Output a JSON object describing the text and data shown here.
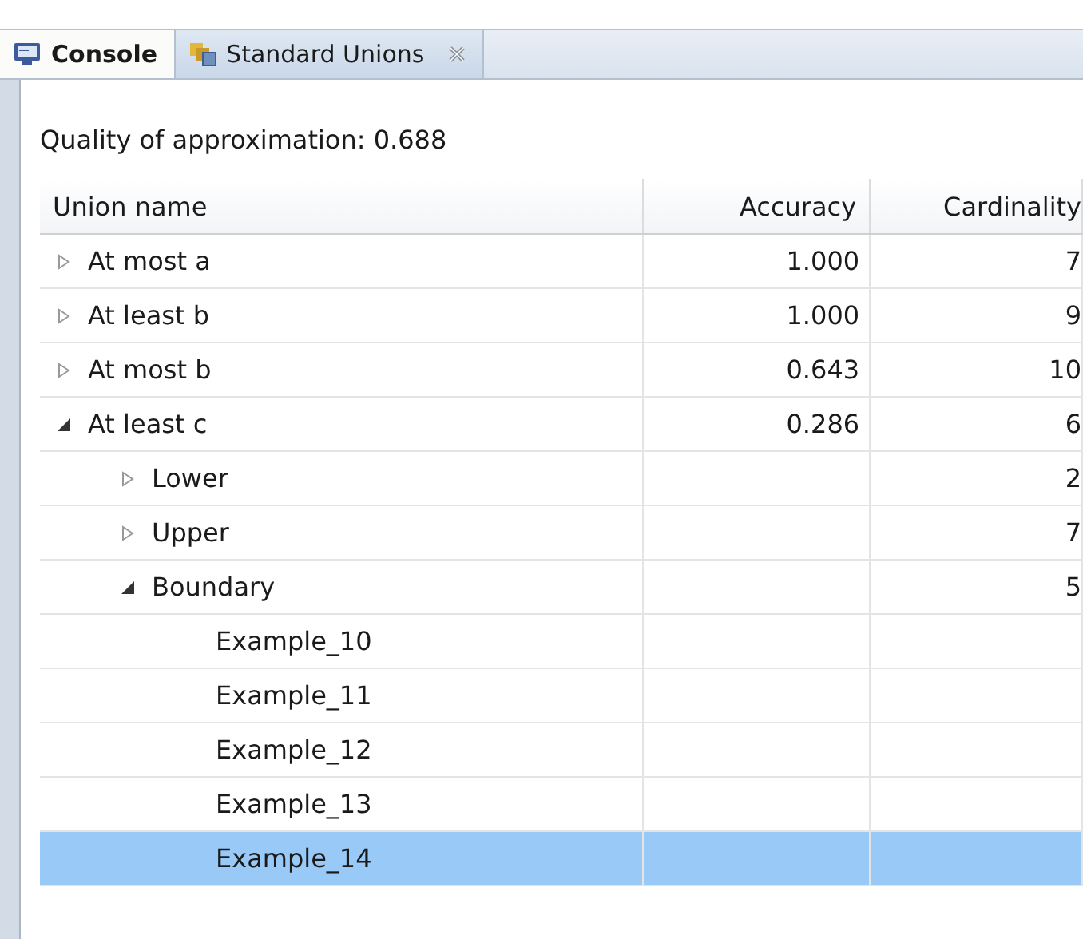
{
  "tabs": [
    {
      "label": "Console",
      "kind": "console",
      "selected": true
    },
    {
      "label": "Standard Unions",
      "kind": "view",
      "selected": false
    }
  ],
  "quality": "Quality of approximation: 0.688",
  "table": {
    "columns": [
      "Union name",
      "Accuracy",
      "Cardinality"
    ],
    "rows": [
      {
        "name": "At most a",
        "accuracy": "1.000",
        "cardinality": "7",
        "expanded": false,
        "selected": false
      },
      {
        "name": "At least b",
        "accuracy": "1.000",
        "cardinality": "9",
        "expanded": false,
        "selected": false
      },
      {
        "name": "At most b",
        "accuracy": "0.643",
        "cardinality": "10",
        "expanded": false,
        "selected": false
      },
      {
        "name": "At least c",
        "accuracy": "0.286",
        "cardinality": "6",
        "expanded": true,
        "selected": false,
        "children": [
          {
            "name": "Lower",
            "cardinality": "2",
            "expanded": false,
            "selected": false
          },
          {
            "name": "Upper",
            "cardinality": "7",
            "expanded": false,
            "selected": false
          },
          {
            "name": "Boundary",
            "cardinality": "5",
            "expanded": true,
            "selected": false,
            "children": [
              {
                "name": "Example_10",
                "selected": false
              },
              {
                "name": "Example_11",
                "selected": false
              },
              {
                "name": "Example_12",
                "selected": false
              },
              {
                "name": "Example_13",
                "selected": false
              },
              {
                "name": "Example_14",
                "selected": true
              }
            ]
          }
        ]
      }
    ]
  }
}
